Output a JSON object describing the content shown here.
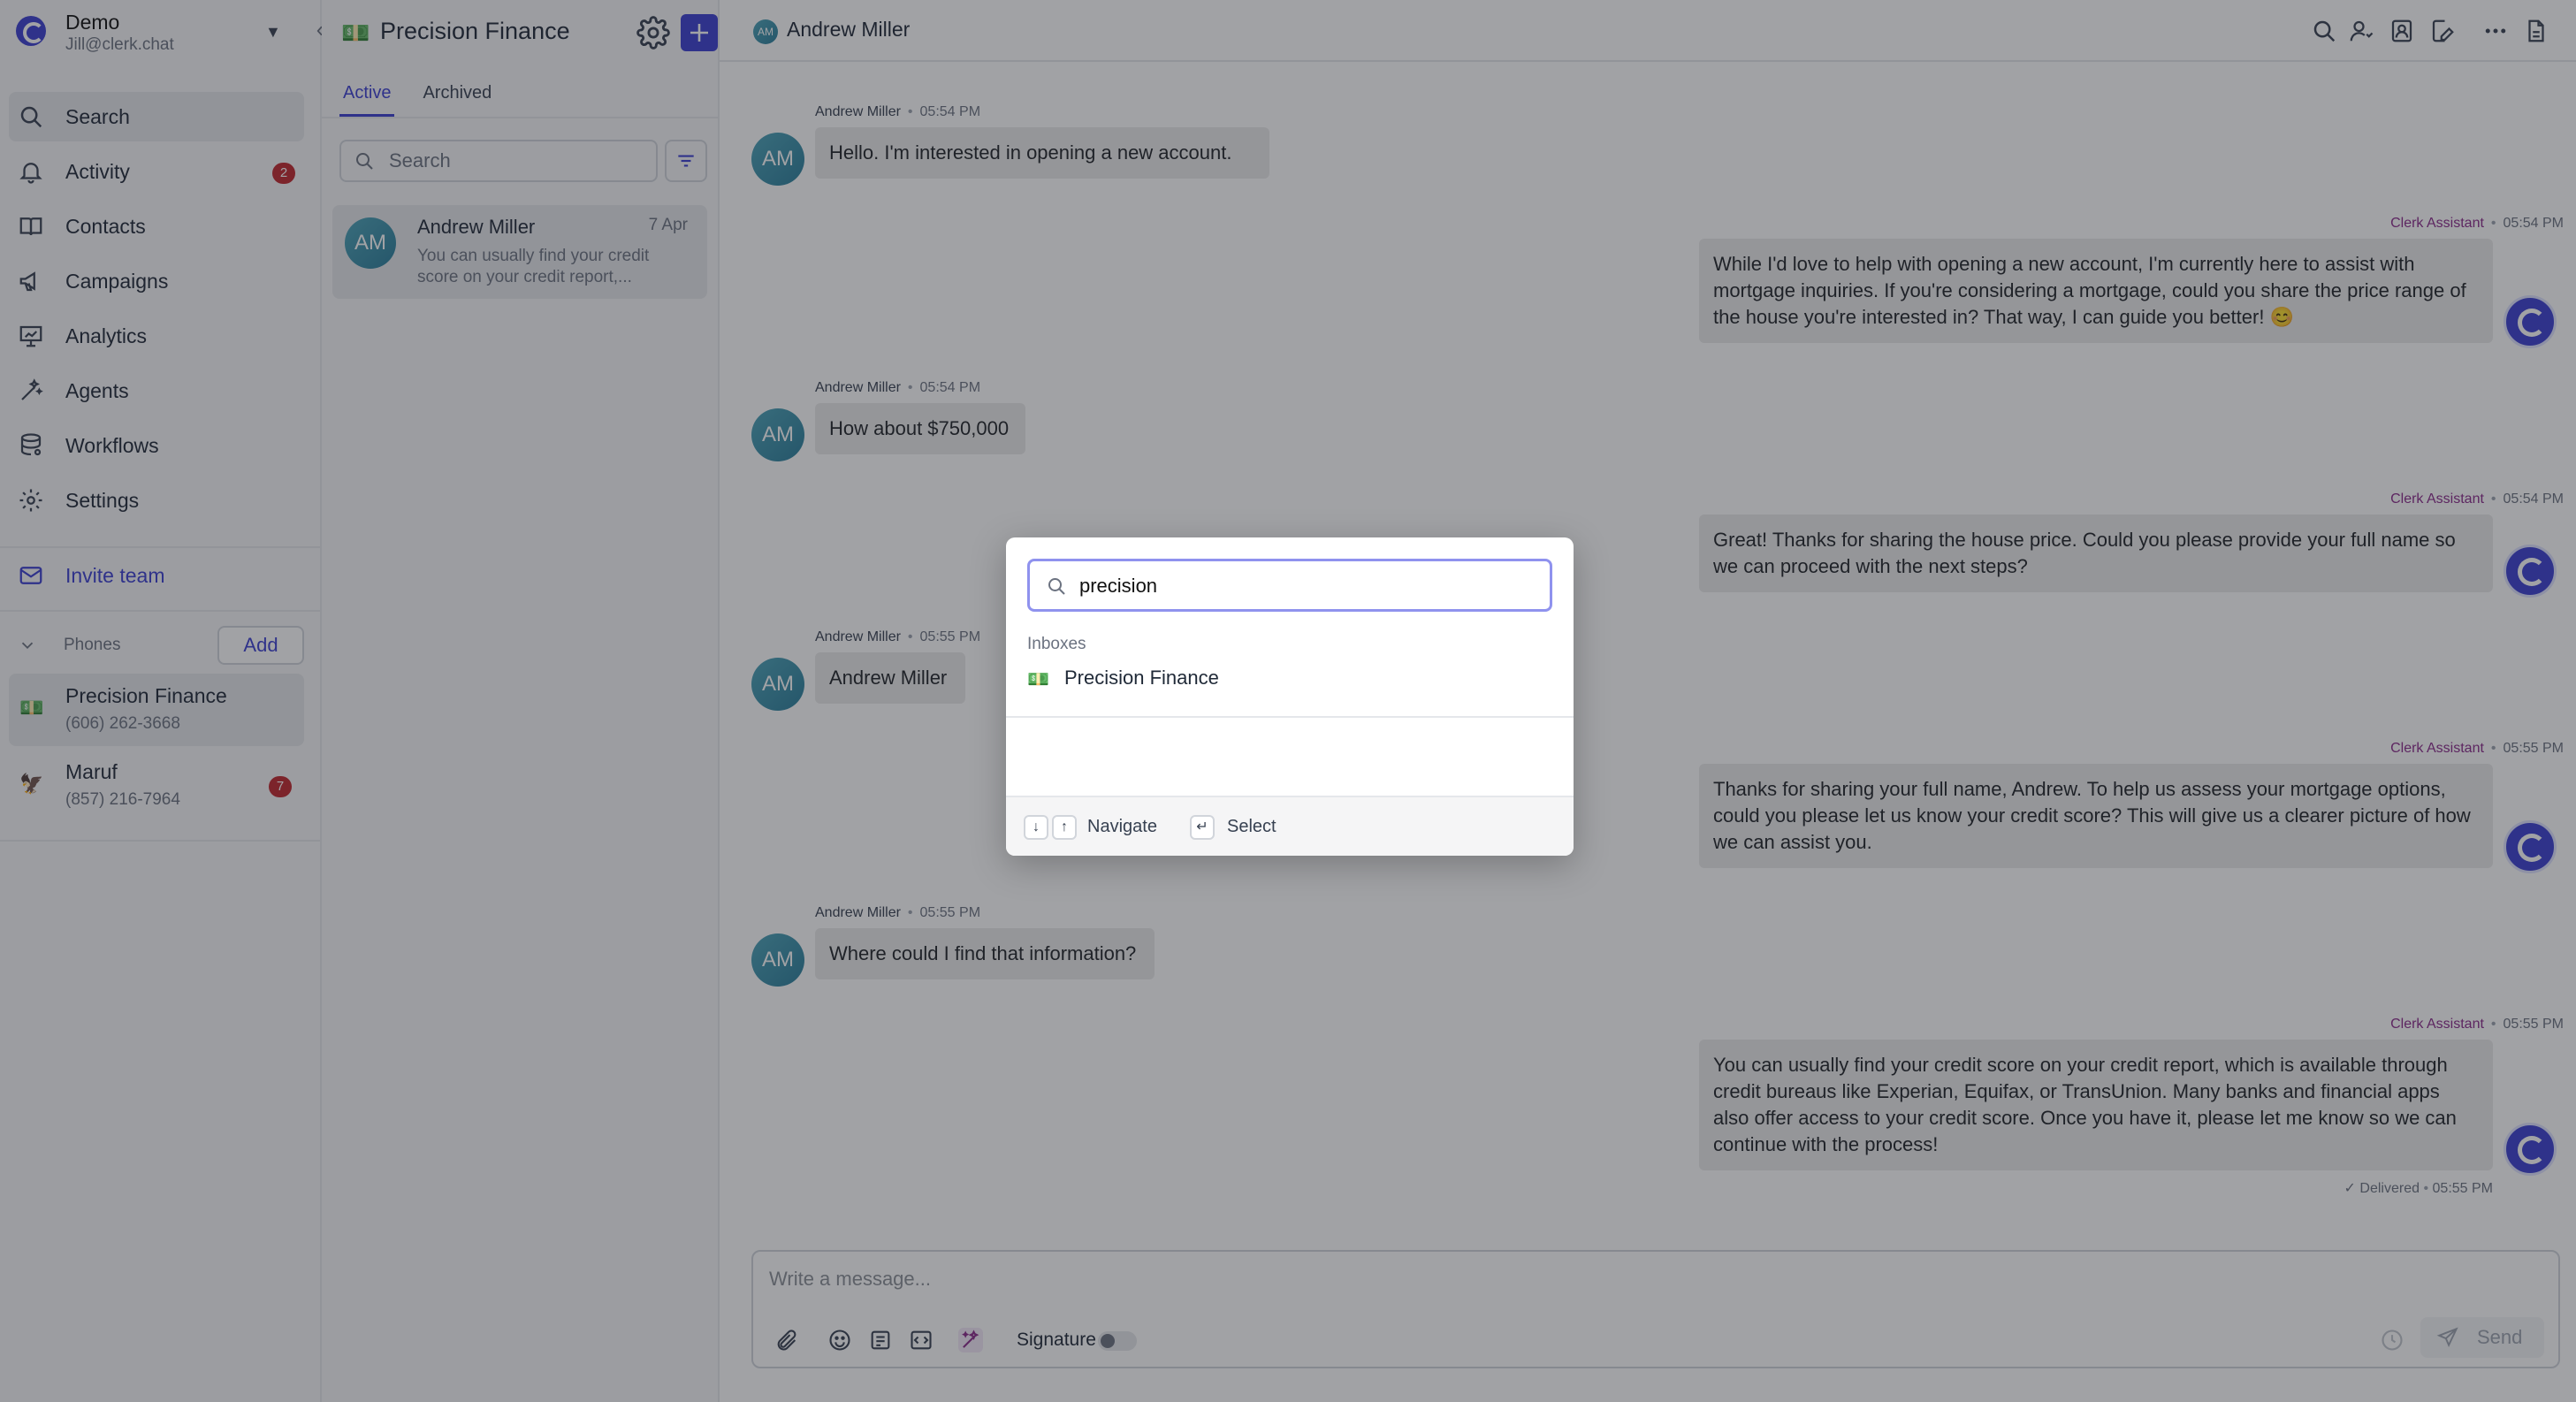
{
  "workspace": {
    "name": "Demo",
    "email": "Jill@clerk.chat"
  },
  "nav": [
    {
      "label": "Search",
      "icon": "search-icon",
      "active": true
    },
    {
      "label": "Activity",
      "icon": "bell-icon",
      "badge": "2"
    },
    {
      "label": "Contacts",
      "icon": "book-icon"
    },
    {
      "label": "Campaigns",
      "icon": "megaphone-icon"
    },
    {
      "label": "Analytics",
      "icon": "presentation-chart-icon"
    },
    {
      "label": "Agents",
      "icon": "magic-wand-icon"
    },
    {
      "label": "Workflows",
      "icon": "database-stack-icon"
    },
    {
      "label": "Settings",
      "icon": "gear-icon"
    }
  ],
  "invite": {
    "label": "Invite team"
  },
  "phones": {
    "label": "Phones",
    "add_label": "Add",
    "items": [
      {
        "name": "Precision Finance",
        "number": "(606) 262-3668",
        "flag": "money-flag-icon"
      },
      {
        "name": "Maruf",
        "number": "(857) 216-7964",
        "badge": "7",
        "flag": "eagle-flag-icon"
      }
    ]
  },
  "inbox": {
    "title": "Precision Finance",
    "tabs": [
      "Active",
      "Archived"
    ],
    "search_placeholder": "Search",
    "conversation": {
      "initials": "AM",
      "name": "Andrew Miller",
      "date": "7 Apr",
      "preview": "You can usually find your credit score on your credit report,..."
    }
  },
  "chat": {
    "contact_initials": "AM",
    "contact_name": "Andrew Miller",
    "messages": [
      {
        "side": "left",
        "sender": "Andrew Miller",
        "time": "05:54 PM",
        "text": "Hello. I'm interested in opening a new account."
      },
      {
        "side": "right",
        "sender": "Clerk Assistant",
        "time": "05:54 PM",
        "text": "While I'd love to help with opening a new account, I'm currently here to assist with mortgage inquiries. If you're considering a mortgage, could you share the price range of the house you're interested in? That way, I can guide you better! 😊"
      },
      {
        "side": "left",
        "sender": "Andrew Miller",
        "time": "05:54 PM",
        "text": "How about $750,000"
      },
      {
        "side": "right",
        "sender": "Clerk Assistant",
        "time": "05:54 PM",
        "text": "Great! Thanks for sharing the house price. Could you please provide your full name so we can proceed with the next steps?"
      },
      {
        "side": "left",
        "sender": "Andrew Miller",
        "time": "05:55 PM",
        "text": "Andrew Miller"
      },
      {
        "side": "right",
        "sender": "Clerk Assistant",
        "time": "05:55 PM",
        "text": "Thanks for sharing your full name, Andrew. To help us assess your mortgage options, could you please let us know your credit score? This will give us a clearer picture of how we can assist you."
      },
      {
        "side": "left",
        "sender": "Andrew Miller",
        "time": "05:55 PM",
        "text": "Where could I find that information?"
      },
      {
        "side": "right",
        "sender": "Clerk Assistant",
        "time": "05:55 PM",
        "text": "You can usually find your credit score on your credit report, which is available through credit bureaus like Experian, Equifax, or TransUnion. Many banks and financial apps also offer access to your credit score. Once you have it, please let me know so we can continue with the process!"
      }
    ],
    "delivered_label": "Delivered",
    "delivered_time": "05:55 PM"
  },
  "composer": {
    "placeholder": "Write a message...",
    "signature_label": "Signature",
    "send_label": "Send"
  },
  "modal": {
    "query": "precision",
    "section_label": "Inboxes",
    "result_name": "Precision Finance",
    "navigate_label": "Navigate",
    "select_label": "Select"
  }
}
